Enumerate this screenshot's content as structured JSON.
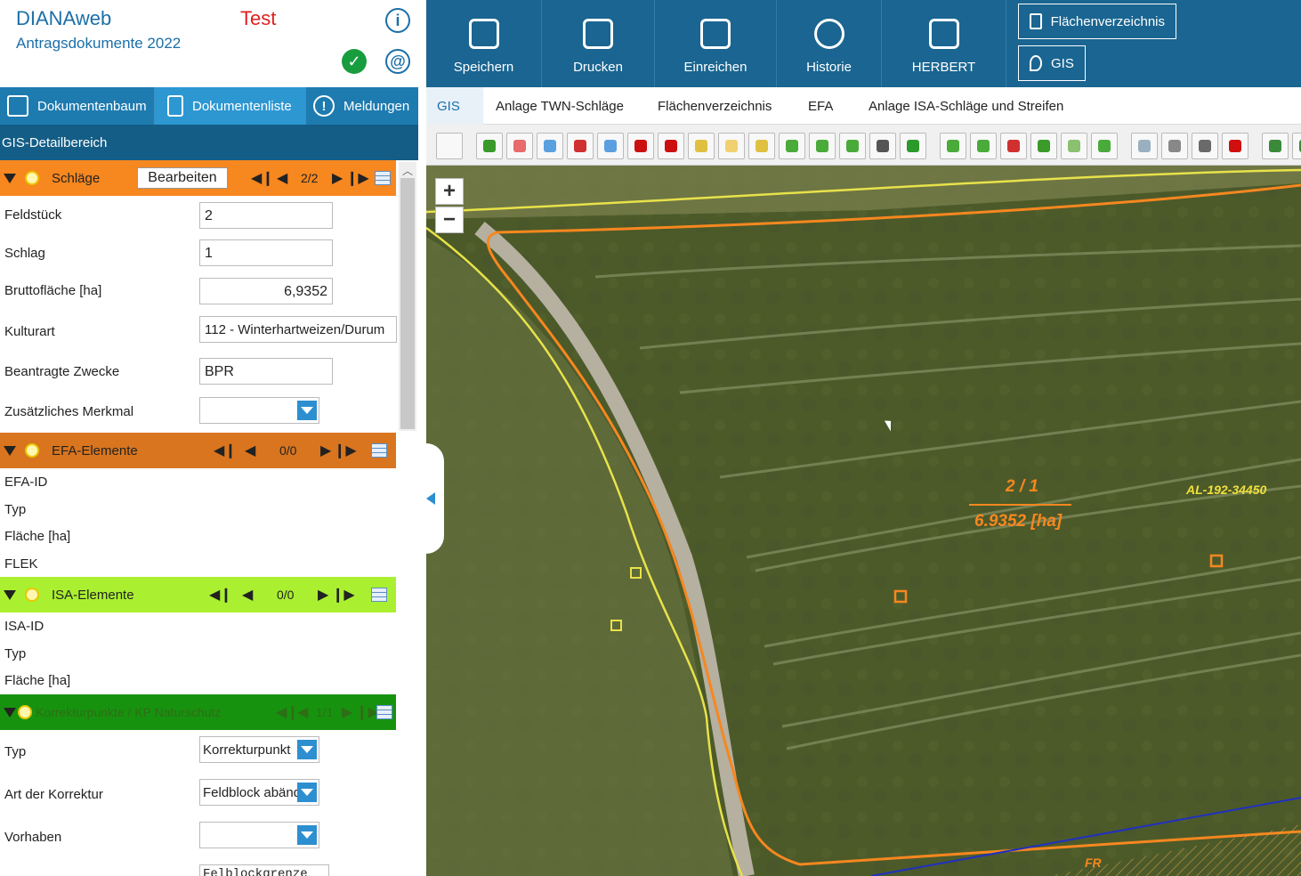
{
  "header": {
    "app_name": "DIANAweb",
    "subtitle": "Antragsdokumente 2022",
    "env": "Test"
  },
  "left_tabs": [
    {
      "label": "Dokumentenbaum"
    },
    {
      "label": "Dokumentenliste"
    },
    {
      "label": "Meldungen"
    }
  ],
  "gis_detail": "GIS-Detailbereich",
  "schlaege": {
    "title": "Schläge",
    "edit": "Bearbeiten",
    "count": "2/2",
    "fields": {
      "feldstueck_label": "Feldstück",
      "feldstueck": "2",
      "schlag_label": "Schlag",
      "schlag": "1",
      "brutto_label": "Bruttofläche [ha]",
      "brutto": "6,9352",
      "kulturart_label": "Kulturart",
      "kulturart": "112 - Winterhartweizen/Durum",
      "zwecke_label": "Beantragte Zwecke",
      "zwecke": "BPR",
      "merkmal_label": "Zusätzliches Merkmal",
      "merkmal": ""
    }
  },
  "efa": {
    "title": "EFA-Elemente",
    "count": "0/0",
    "labels": [
      "EFA-ID",
      "Typ",
      "Fläche [ha]",
      "FLEK"
    ]
  },
  "isa": {
    "title": "ISA-Elemente",
    "count": "0/0",
    "labels": [
      "ISA-ID",
      "Typ",
      "Fläche [ha]"
    ]
  },
  "korr": {
    "title": "Korrekturpunkte / KP Naturschutz",
    "count": "1/1",
    "typ_label": "Typ",
    "typ": "Korrekturpunkt",
    "art_label": "Art der Korrektur",
    "art": "Feldblock abänd",
    "vorhaben_label": "Vorhaben",
    "vorhaben": "",
    "text": "Felblockgrenze"
  },
  "topbar": {
    "buttons": [
      "Speichern",
      "Drucken",
      "Einreichen",
      "Historie",
      "HERBERT"
    ],
    "flaechen": "Flächenverzeichnis",
    "gis": "GIS"
  },
  "gis_tabs": [
    "GIS",
    "Anlage TWN-Schläge",
    "Flächenverzeichnis",
    "EFA",
    "Anlage ISA-Schläge und Streifen"
  ],
  "map": {
    "parcel_id": "2 / 1",
    "parcel_area": "6.9352 [ha]",
    "al_label": "AL-192-34450",
    "fr_label": "FR",
    "zoom_in": "+",
    "zoom_out": "−"
  },
  "colors": {
    "orange": "#f7871f",
    "efa": "#d9751f",
    "isa": "#aaf030",
    "korr": "#17920f",
    "blue": "#1a6591"
  }
}
